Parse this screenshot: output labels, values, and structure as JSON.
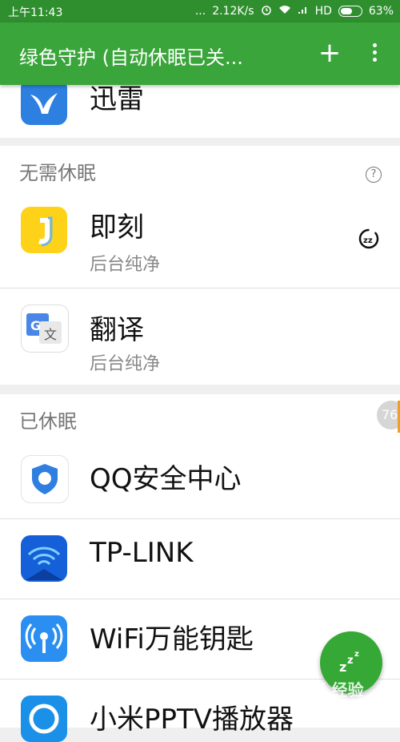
{
  "status_bar": {
    "time": "上午11:43",
    "dots": "...",
    "speed": "2.12K/s",
    "network": "HD",
    "battery": "63%",
    "battery_level": 0.63
  },
  "toolbar": {
    "title": "绿色守护 (自动休眠已关...",
    "add_label": "+"
  },
  "top_partial": {
    "name": "迅雷"
  },
  "sections": {
    "no_sleep": {
      "title": "无需休眠",
      "help_label": "?",
      "items": [
        {
          "name": "即刻",
          "status": "后台纯净",
          "icon": "jike-icon"
        },
        {
          "name": "翻译",
          "status": "后台纯净",
          "icon": "google-translate-icon"
        }
      ]
    },
    "hibernated": {
      "title": "已休眠",
      "badge": "76",
      "items": [
        {
          "name": "QQ安全中心",
          "icon": "qq-security-icon"
        },
        {
          "name": "TP-LINK",
          "icon": "tplink-icon"
        },
        {
          "name": "WiFi万能钥匙",
          "icon": "wifi-key-icon"
        },
        {
          "name": "小米PPTV播放器",
          "icon": "pptv-icon"
        }
      ]
    }
  },
  "watermark": "Bai 经验",
  "colors": {
    "status_bar": "#2f8f2f",
    "toolbar": "#3aa53a",
    "fab": "#35a835"
  }
}
